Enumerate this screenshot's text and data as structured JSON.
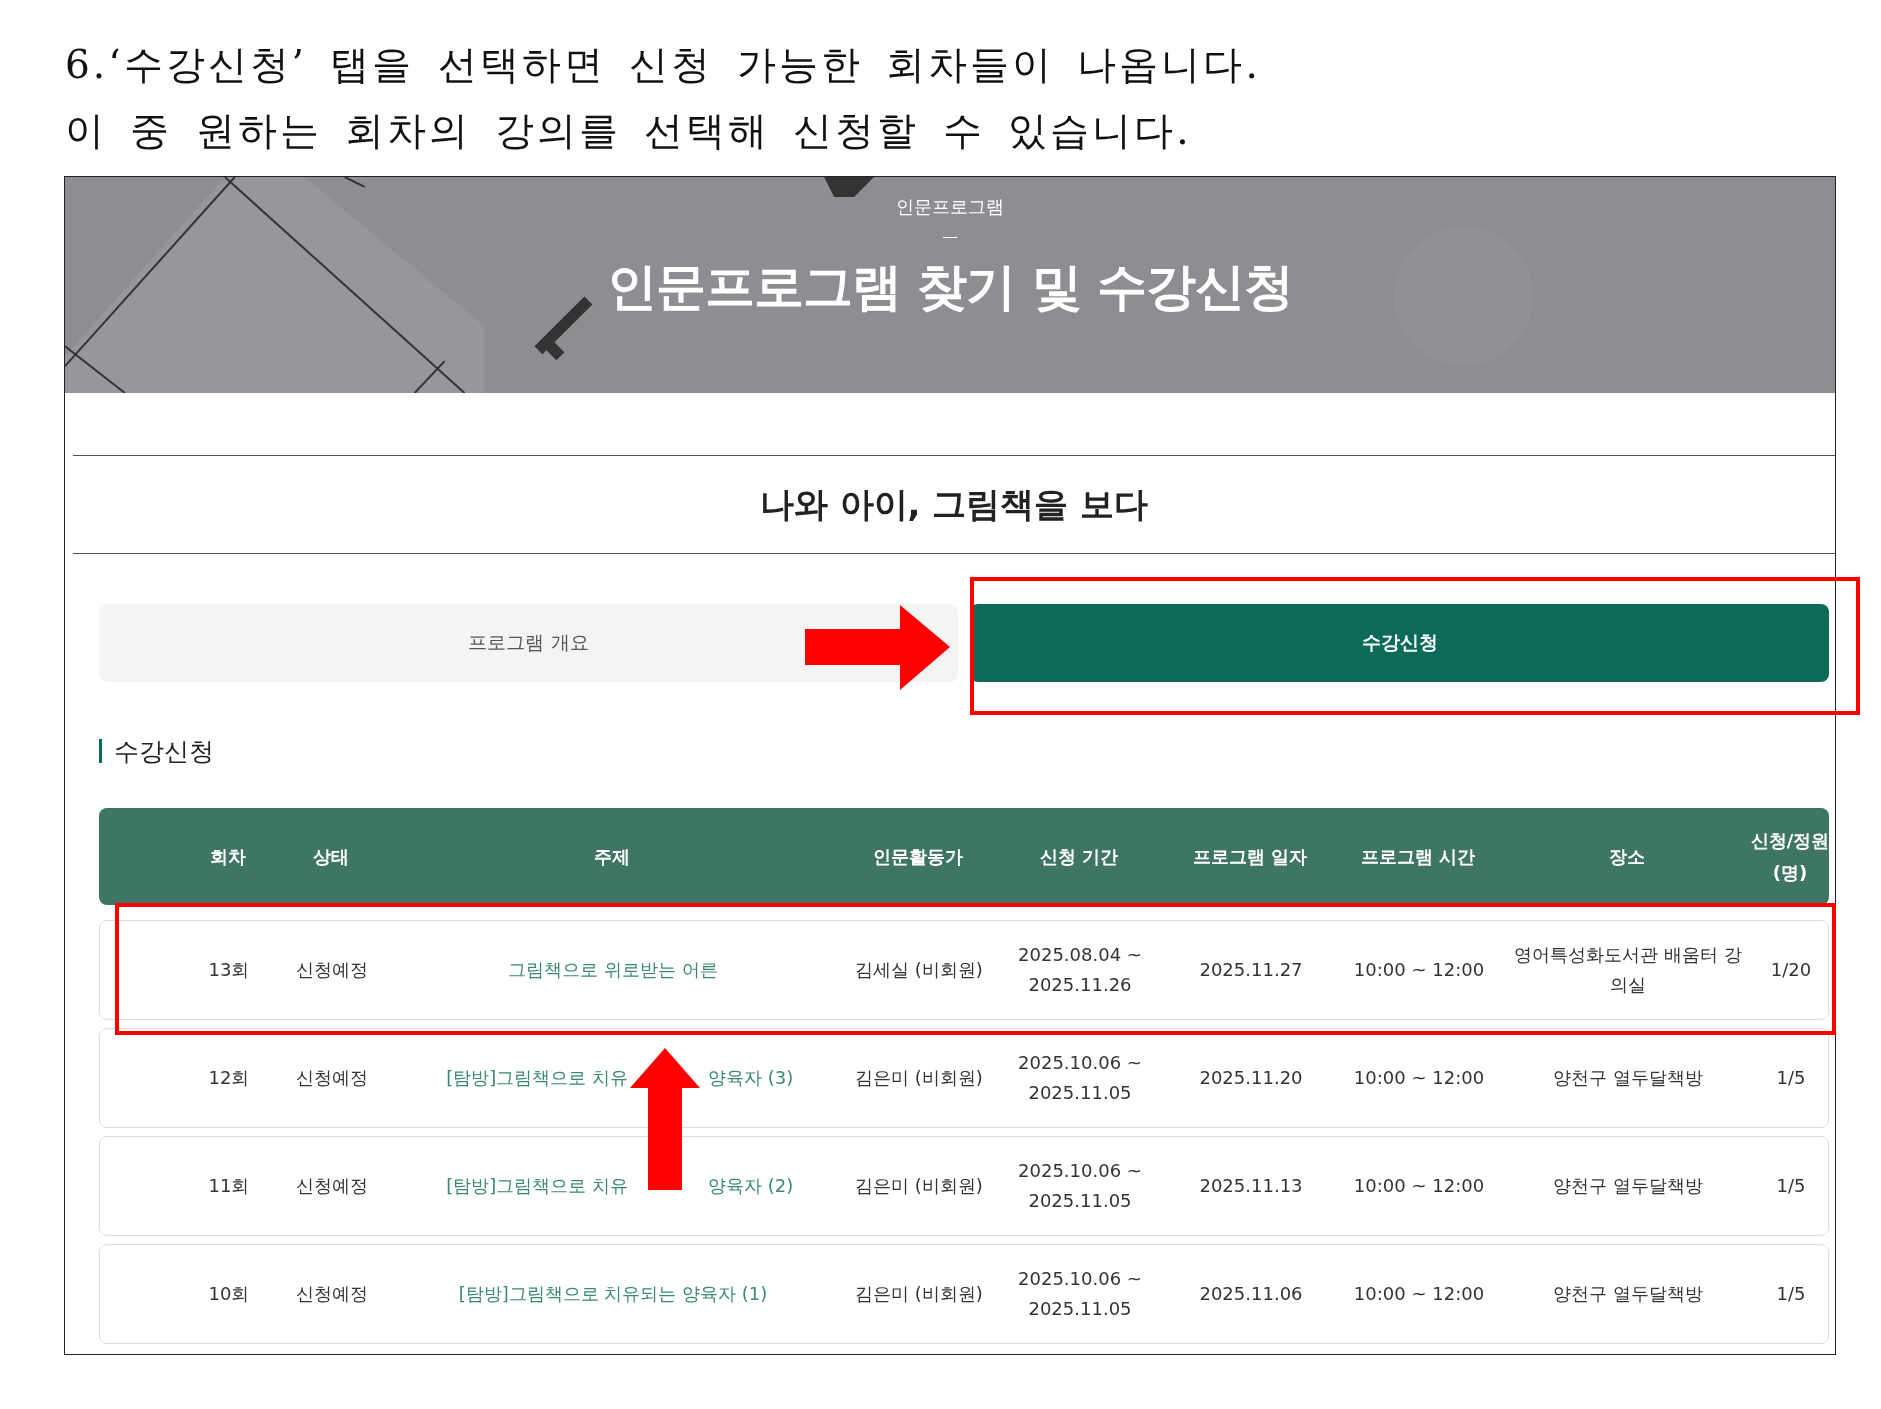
{
  "instructions": [
    "6.‘수강신청’ 탭을 선택하면 신청 가능한 회차들이 나옵니다.",
    "이 중 원하는 회차의 강의를 선택해 신청할 수 있습니다."
  ],
  "banner": {
    "kind": "picture",
    "kicker": "인문프로그램",
    "title": "인문프로그램 찾기 및 수강신청"
  },
  "program_title": "나와 아이, 그림책을 보다",
  "tabs": [
    {
      "label": "프로그램 개요",
      "selected": false
    },
    {
      "label": "수강신청",
      "selected": true
    }
  ],
  "section_heading": "수강신청",
  "table": {
    "columns": [
      "",
      "회차",
      "상태",
      "주제",
      "인문활동가",
      "신청 기간",
      "프로그램 일자",
      "프로그램 시간",
      "장소",
      "신청/정원(명)"
    ],
    "rows": [
      {
        "round": "13회",
        "status": "신청예정",
        "topic": "그림책으로 위로받는 어른",
        "instructor": "김세실 (비회원)",
        "period": "2025.08.04 ~ 2025.11.26",
        "date": "2025.11.27",
        "time": "10:00 ~ 12:00",
        "place": "영어특성화도서관 배움터 강의실",
        "count": "1/20",
        "highlighted": true
      },
      {
        "round": "12회",
        "status": "신청예정",
        "topic": "[탐방]그림책으로 치유",
        "topic_tail": "양육자 (3)",
        "instructor": "김은미 (비회원)",
        "period": "2025.10.06 ~ 2025.11.05",
        "date": "2025.11.20",
        "time": "10:00 ~ 12:00",
        "place": "양천구 열두달책방",
        "count": "1/5",
        "highlighted": false
      },
      {
        "round": "11회",
        "status": "신청예정",
        "topic": "[탐방]그림책으로 치유",
        "topic_tail": "양육자 (2)",
        "instructor": "김은미 (비회원)",
        "period": "2025.10.06 ~ 2025.11.05",
        "date": "2025.11.13",
        "time": "10:00 ~ 12:00",
        "place": "양천구 열두달책방",
        "count": "1/5",
        "highlighted": false
      },
      {
        "round": "10회",
        "status": "신청예정",
        "topic": "[탐방]그림책으로 치유되는 양육자 (1)",
        "instructor": "김은미 (비회원)",
        "period": "2025.10.06 ~ 2025.11.05",
        "date": "2025.11.06",
        "time": "10:00 ~ 12:00",
        "place": "양천구 열두달책방",
        "count": "1/5",
        "highlighted": false
      }
    ]
  }
}
